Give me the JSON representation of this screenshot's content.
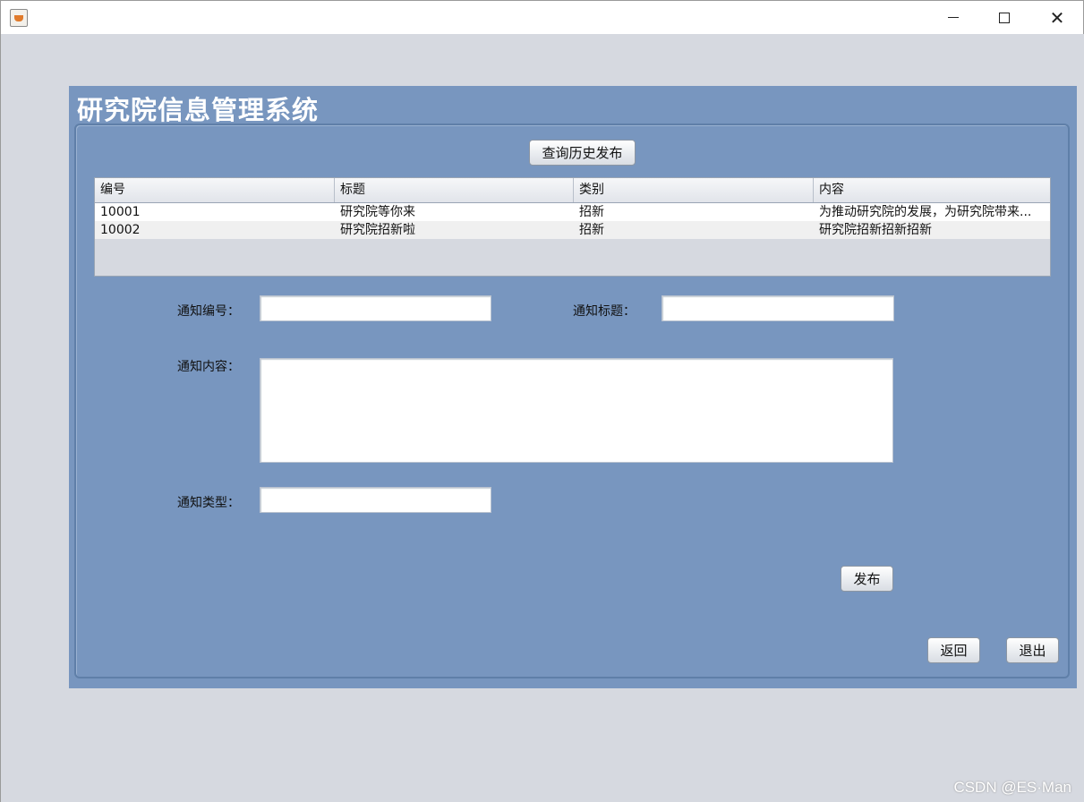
{
  "window": {
    "title": "",
    "controls": {
      "minimize": "minimize-icon",
      "maximize": "maximize-icon",
      "close": "close-icon"
    }
  },
  "app": {
    "title": "研究院信息管理系统"
  },
  "toolbar": {
    "query_history": "查询历史发布"
  },
  "table": {
    "columns": [
      "编号",
      "标题",
      "类别",
      "内容"
    ],
    "rows": [
      [
        "10001",
        "研究院等你来",
        "招新",
        "为推动研究院的发展，为研究院带来..."
      ],
      [
        "10002",
        "研究院招新啦",
        "招新",
        "研究院招新招新招新"
      ]
    ]
  },
  "form": {
    "id_label": "通知编号：",
    "title_label": "通知标题：",
    "content_label": "通知内容：",
    "type_label": "通知类型：",
    "id_value": "",
    "title_value": "",
    "content_value": "",
    "type_value": ""
  },
  "actions": {
    "publish": "发布",
    "back": "返回",
    "exit": "退出"
  },
  "watermark": "CSDN @ES·Man",
  "colors": {
    "panel": "#7896bf",
    "background": "#d6d9e0"
  }
}
